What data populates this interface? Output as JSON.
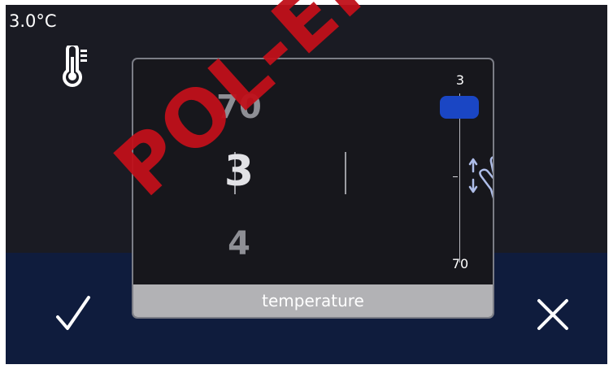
{
  "status": {
    "current_temperature": "3.0°C"
  },
  "dialog": {
    "value_previous": "70",
    "value_current": "3",
    "value_next": "4",
    "scale_max_label": "3",
    "scale_min_label": "70",
    "footer_label": "temperature"
  },
  "watermark": {
    "text": "POL-EKO"
  },
  "icons": {
    "thermometer": "thermometer-icon",
    "hand": "hand-pointer-icon",
    "confirm": "checkmark-icon",
    "cancel": "close-icon"
  },
  "colors": {
    "screen_background": "#1a1b23",
    "screen_bottom": "#0f1c3d",
    "dialog_border": "#7b7d86",
    "footer_bar": "#b2b2b5",
    "scale_thumb": "#1a46c4",
    "hand_outline": "#aebde8",
    "watermark": "#c0101a"
  }
}
